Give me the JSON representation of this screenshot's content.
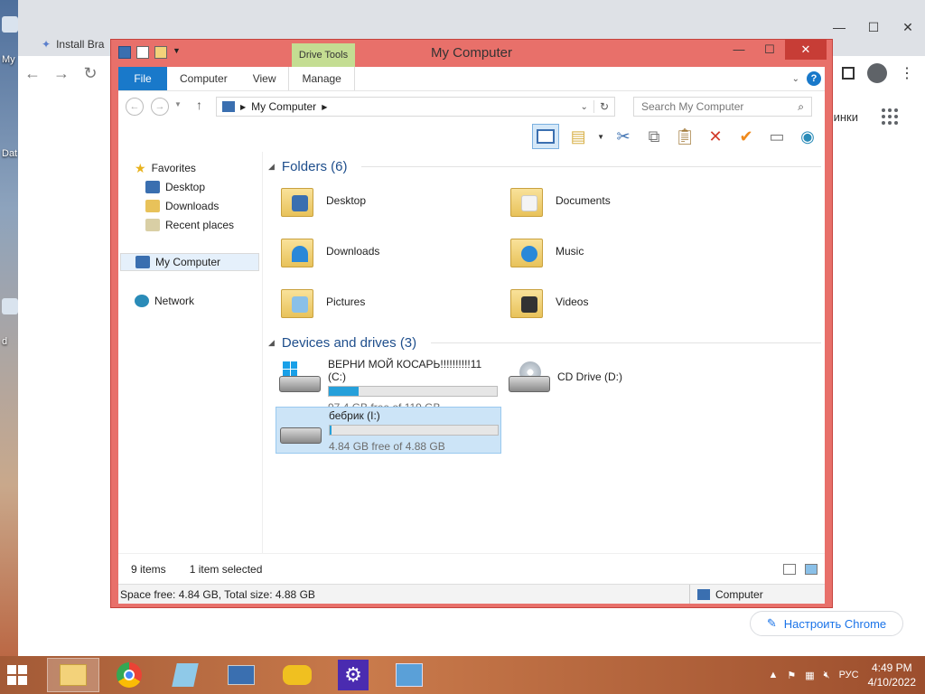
{
  "desktop": {
    "labels": [
      "My",
      "Dat",
      "d"
    ]
  },
  "chrome": {
    "tab1_label": "Install Bra",
    "apps_label": "инки",
    "customize_label": "Настроить Chrome"
  },
  "explorer": {
    "title": "My Computer",
    "drive_tools": "Drive Tools",
    "tabs": {
      "file": "File",
      "computer": "Computer",
      "view": "View",
      "manage": "Manage"
    },
    "address": "My Computer",
    "search_placeholder": "Search My Computer",
    "nav": {
      "favorites": "Favorites",
      "desktop": "Desktop",
      "downloads": "Downloads",
      "recent": "Recent places",
      "my_computer": "My Computer",
      "network": "Network"
    },
    "folders_header": "Folders (6)",
    "folders": [
      "Desktop",
      "Documents",
      "Downloads",
      "Music",
      "Pictures",
      "Videos"
    ],
    "devices_header": "Devices and drives (3)",
    "drives": [
      {
        "name": "ВЕРНИ МОЙ КОСАРЬ!!!!!!!!!!11 (C:)",
        "free": "97.4 GB free of 119 GB",
        "used_fraction": 0.18
      },
      {
        "name": "CD Drive (D:)"
      },
      {
        "name": "бебрик (I:)",
        "free": "4.84 GB free of 4.88 GB",
        "used_fraction": 0.01
      }
    ],
    "status": {
      "items": "9 items",
      "selected": "1 item selected"
    },
    "details": {
      "space": "Space free: 4.84 GB, Total size: 4.88 GB",
      "computer": "Computer"
    }
  },
  "taskbar": {
    "lang": "РУС",
    "time": "4:49 PM",
    "date": "4/10/2022"
  }
}
